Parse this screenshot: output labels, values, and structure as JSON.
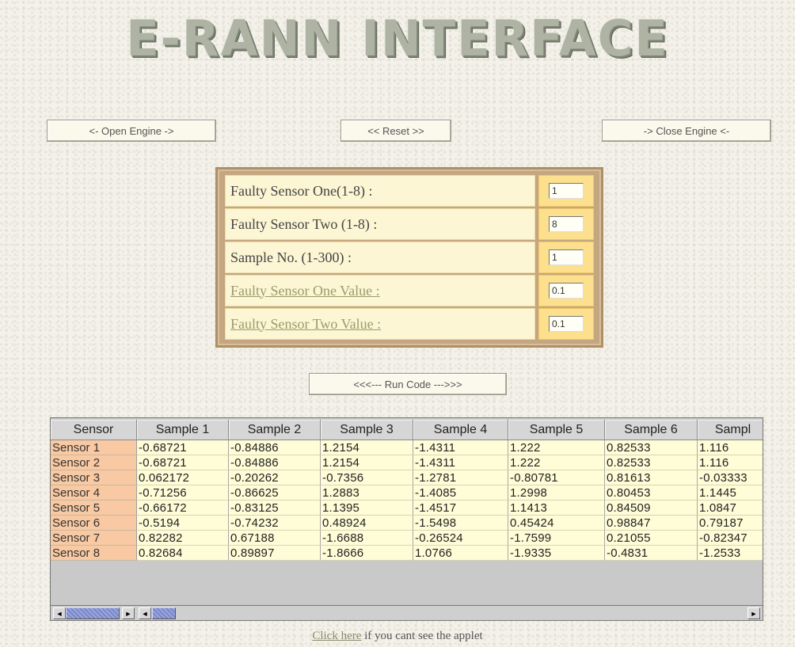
{
  "title": "E-RANN INTERFACE",
  "buttons": {
    "open_engine": "<- Open Engine ->",
    "reset": "<< Reset >>",
    "close_engine": "-> Close Engine <-",
    "run_code": "<<<--- Run Code --->>>"
  },
  "form": {
    "rows": [
      {
        "label": "Faulty Sensor One(1-8) :",
        "value": "1",
        "style": "plain"
      },
      {
        "label": "Faulty Sensor Two (1-8) :",
        "value": "8",
        "style": "plain"
      },
      {
        "label": "Sample No. (1-300) :",
        "value": "1",
        "style": "plain"
      },
      {
        "label": "Faulty Sensor One Value :",
        "value": "0.1",
        "style": "link"
      },
      {
        "label": "Faulty Sensor Two Value :",
        "value": "0.1",
        "style": "link"
      }
    ]
  },
  "table": {
    "columns": [
      "Sensor",
      "Sample 1",
      "Sample 2",
      "Sample 3",
      "Sample 4",
      "Sample 5",
      "Sample 6",
      "Sampl"
    ],
    "rows": [
      [
        "Sensor 1",
        "-0.68721",
        "-0.84886",
        "1.2154",
        "-1.4311",
        "1.222",
        "0.82533",
        "1.116"
      ],
      [
        "Sensor 2",
        "-0.68721",
        "-0.84886",
        "1.2154",
        "-1.4311",
        "1.222",
        "0.82533",
        "1.116"
      ],
      [
        "Sensor 3",
        "0.062172",
        "-0.20262",
        "-0.7356",
        "-1.2781",
        "-0.80781",
        "0.81613",
        "-0.03333"
      ],
      [
        "Sensor 4",
        "-0.71256",
        "-0.86625",
        "1.2883",
        "-1.4085",
        "1.2998",
        "0.80453",
        "1.1445"
      ],
      [
        "Sensor 5",
        "-0.66172",
        "-0.83125",
        "1.1395",
        "-1.4517",
        "1.1413",
        "0.84509",
        "1.0847"
      ],
      [
        "Sensor 6",
        "-0.5194",
        "-0.74232",
        "0.48924",
        "-1.5498",
        "0.45424",
        "0.98847",
        "0.79187"
      ],
      [
        "Sensor 7",
        "0.82282",
        "0.67188",
        "-1.6688",
        "-0.26524",
        "-1.7599",
        "0.21055",
        "-0.82347"
      ],
      [
        "Sensor 8",
        "0.82684",
        "0.89897",
        "-1.8666",
        "1.0766",
        "-1.9335",
        "-0.4831",
        "-1.2533"
      ]
    ]
  },
  "scrollbar": {
    "left_arrow": "◄",
    "right_arrow": "►"
  },
  "footer": {
    "link": "Click here",
    "text": " if you cant see the applet"
  },
  "colors": {
    "panel_border": "#b08e66",
    "label_bg": "#fdf6d4",
    "value_bg": "#fce08e",
    "sensor_bg": "#f8c9a2",
    "cell_bg": "#fffdd7"
  }
}
